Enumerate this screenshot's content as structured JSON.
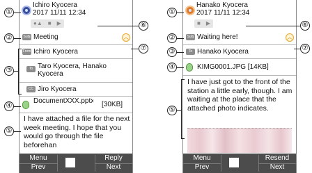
{
  "left": {
    "sender_name": "Ichiro Kyocera",
    "date": "2017 11/11 12:34",
    "status_icons": [
      "person-icon",
      "lock-icon",
      "flag-icon"
    ],
    "subject_tag": "Subj",
    "subject": "Meeting",
    "from_tag": "From",
    "from": "Ichiro Kyocera",
    "to_tag": "To",
    "to": "Taro Kyocera, Hanako Kyocera",
    "cc_tag": "CC",
    "cc": "Jiro Kyocera",
    "attachment_name": "DocumentXXX.pptx",
    "attachment_size": "[30KB]",
    "body": "I have attached a file for the next week meeting. I hope that you would go through the file beforehan",
    "softkeys": {
      "top_left": "Menu",
      "bottom_left": "Prev",
      "top_right": "Reply",
      "bottom_right": "Next"
    }
  },
  "right": {
    "sender_name": "Hanako Kyocera",
    "date": "2017 11/11 12:34",
    "status_icons": [
      "lock-icon",
      "flag-icon"
    ],
    "subject_tag": "Subj",
    "subject": "Waiting here!",
    "to_tag": "To",
    "to": "Hanako Kyocera",
    "attachment_name": "KIMG0001.JPG [14KB]",
    "body": "I have just got to the front of the station a little early, though. I am waiting at the place that the attached photo indicates.",
    "softkeys": {
      "top_left": "Menu",
      "bottom_left": "Prev",
      "top_right": "Resend",
      "bottom_right": "Next"
    }
  },
  "callouts": [
    "①",
    "②",
    "③",
    "④",
    "⑤",
    "⑥",
    "⑦"
  ]
}
